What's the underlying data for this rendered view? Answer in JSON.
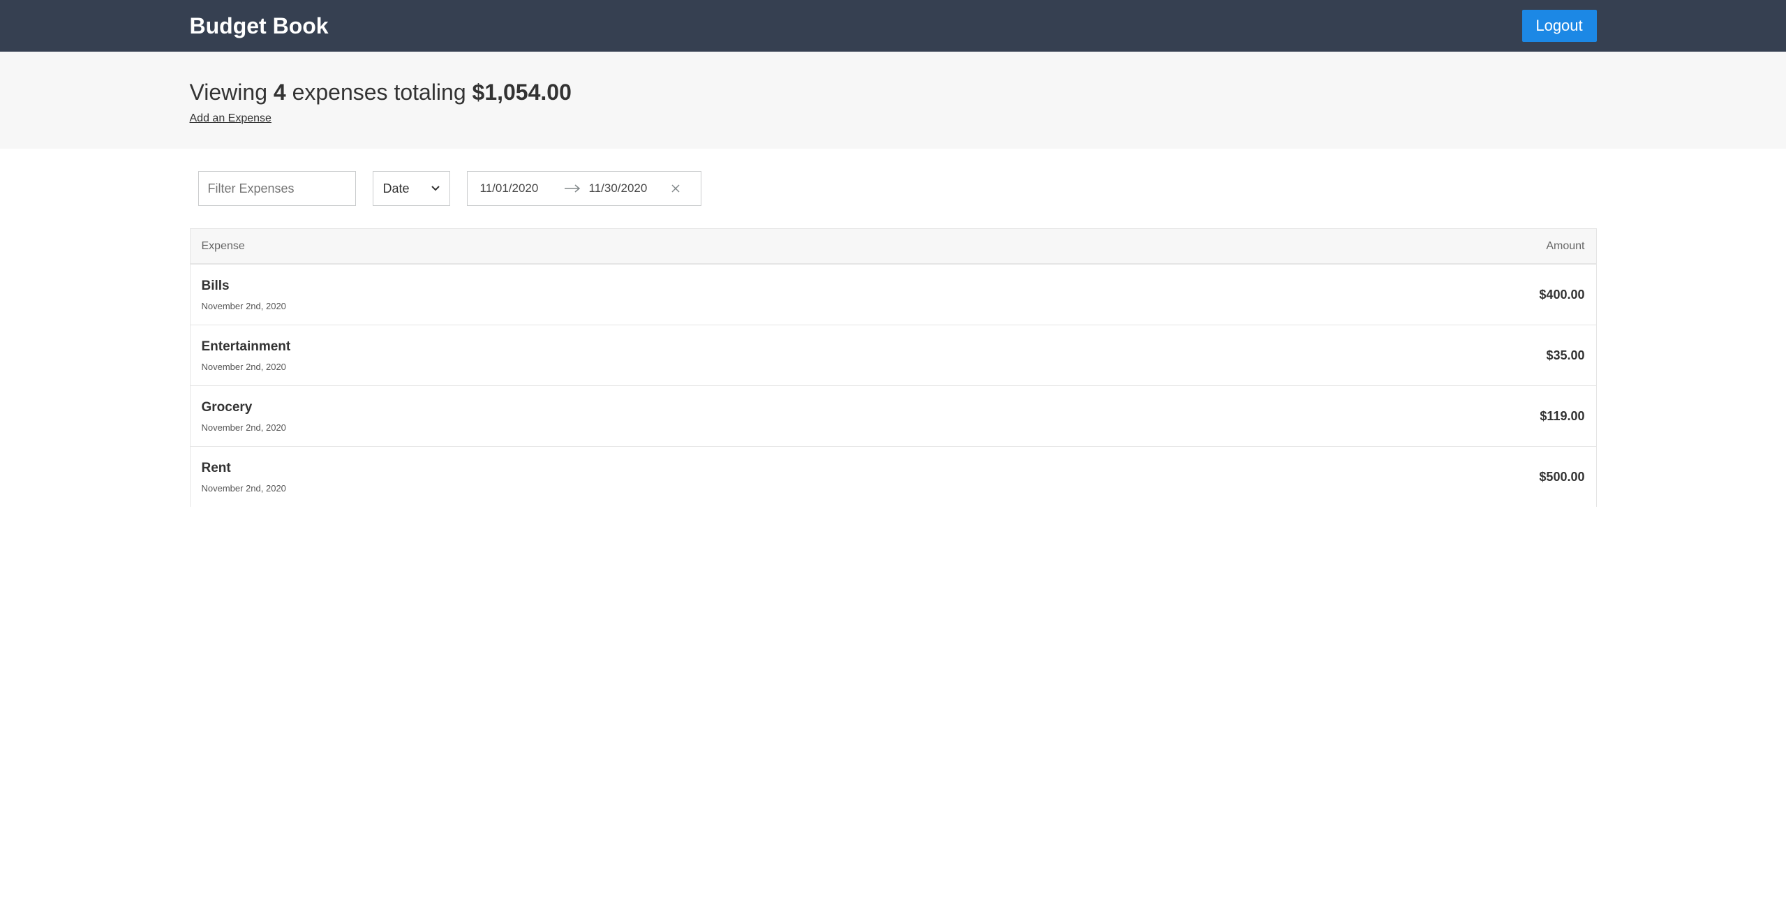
{
  "header": {
    "title": "Budget Book",
    "logout_label": "Logout"
  },
  "summary": {
    "prefix": "Viewing",
    "count": "4",
    "middle": "expenses totaling",
    "total": "$1,054.00",
    "add_link": "Add an Expense"
  },
  "filters": {
    "text_placeholder": "Filter Expenses",
    "text_value": "",
    "sort_by": "Date",
    "start_date": "11/01/2020",
    "end_date": "11/30/2020"
  },
  "table": {
    "col_expense": "Expense",
    "col_amount": "Amount",
    "rows": [
      {
        "description": "Bills",
        "date": "November 2nd, 2020",
        "amount": "$400.00"
      },
      {
        "description": "Entertainment",
        "date": "November 2nd, 2020",
        "amount": "$35.00"
      },
      {
        "description": "Grocery",
        "date": "November 2nd, 2020",
        "amount": "$119.00"
      },
      {
        "description": "Rent",
        "date": "November 2nd, 2020",
        "amount": "$500.00"
      }
    ]
  },
  "colors": {
    "header_bg": "#364051",
    "button_bg": "#1c88e5",
    "summary_bg": "#f7f7f7"
  },
  "icons": {
    "sort_caret": "chevron-down-icon",
    "date_arrow": "arrow-right-icon",
    "date_clear": "close-icon"
  }
}
